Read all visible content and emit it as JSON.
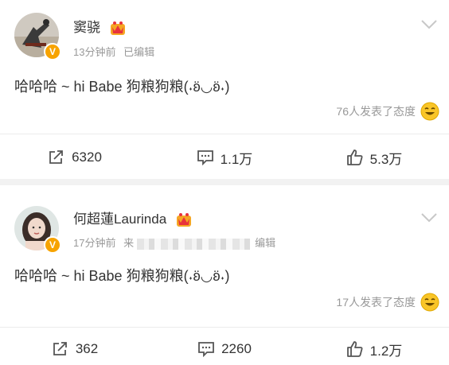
{
  "posts": [
    {
      "name": "窦骁",
      "time": "13分钟前",
      "edited": "已编辑",
      "source_prefix": "",
      "content": "哈哈哈 ~ hi Babe 狗粮狗粮(˖ʚ̈◡ʚ̈˖)",
      "attitude": "76人发表了态度",
      "repost_count": "6320",
      "comment_count": "1.1万",
      "like_count": "5.3万"
    },
    {
      "name": "何超蓮Laurinda",
      "time": "17分钟前",
      "edited": "编辑",
      "source_prefix": "来",
      "content": "哈哈哈 ~ hi Babe 狗粮狗粮(˖ʚ̈◡ʚ̈˖)",
      "attitude": "17人发表了态度",
      "repost_count": "362",
      "comment_count": "2260",
      "like_count": "1.2万"
    }
  ],
  "colors": {
    "badge": "#f7a300",
    "muted": "#999999",
    "text": "#333333",
    "separator": "#f2f2f2"
  },
  "icons": [
    "avatar",
    "verified-badge-icon",
    "crown-icon",
    "chevron-down-icon",
    "smile-emoji-icon",
    "repost-icon",
    "comment-icon",
    "like-icon"
  ]
}
